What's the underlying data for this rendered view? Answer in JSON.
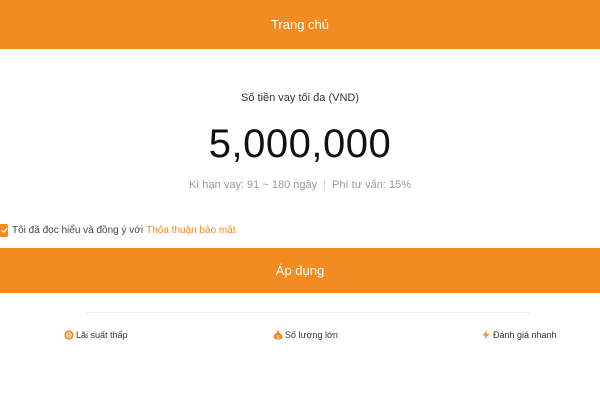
{
  "header": {
    "title": "Trang chủ"
  },
  "loan": {
    "label": "Số tiền vay tối đa (VND)",
    "amount": "5,000,000",
    "term": "Kì hạn vay: 91 ~ 180 ngày",
    "fee": "Phí tư vấn: 15%"
  },
  "agreement": {
    "checked": true,
    "text": "Tôi đã đọc hiểu và đồng ý với",
    "link": "Thỏa thuận bảo mật"
  },
  "apply": {
    "label": "Áp dụng"
  },
  "features": [
    {
      "label": "Lãi suất thấp",
      "icon": "coin-icon"
    },
    {
      "label": "Số lượng lớn",
      "icon": "money-bag-icon"
    },
    {
      "label": "Đánh giá nhanh",
      "icon": "lightning-icon"
    }
  ],
  "colors": {
    "accent": "#f28c22"
  }
}
